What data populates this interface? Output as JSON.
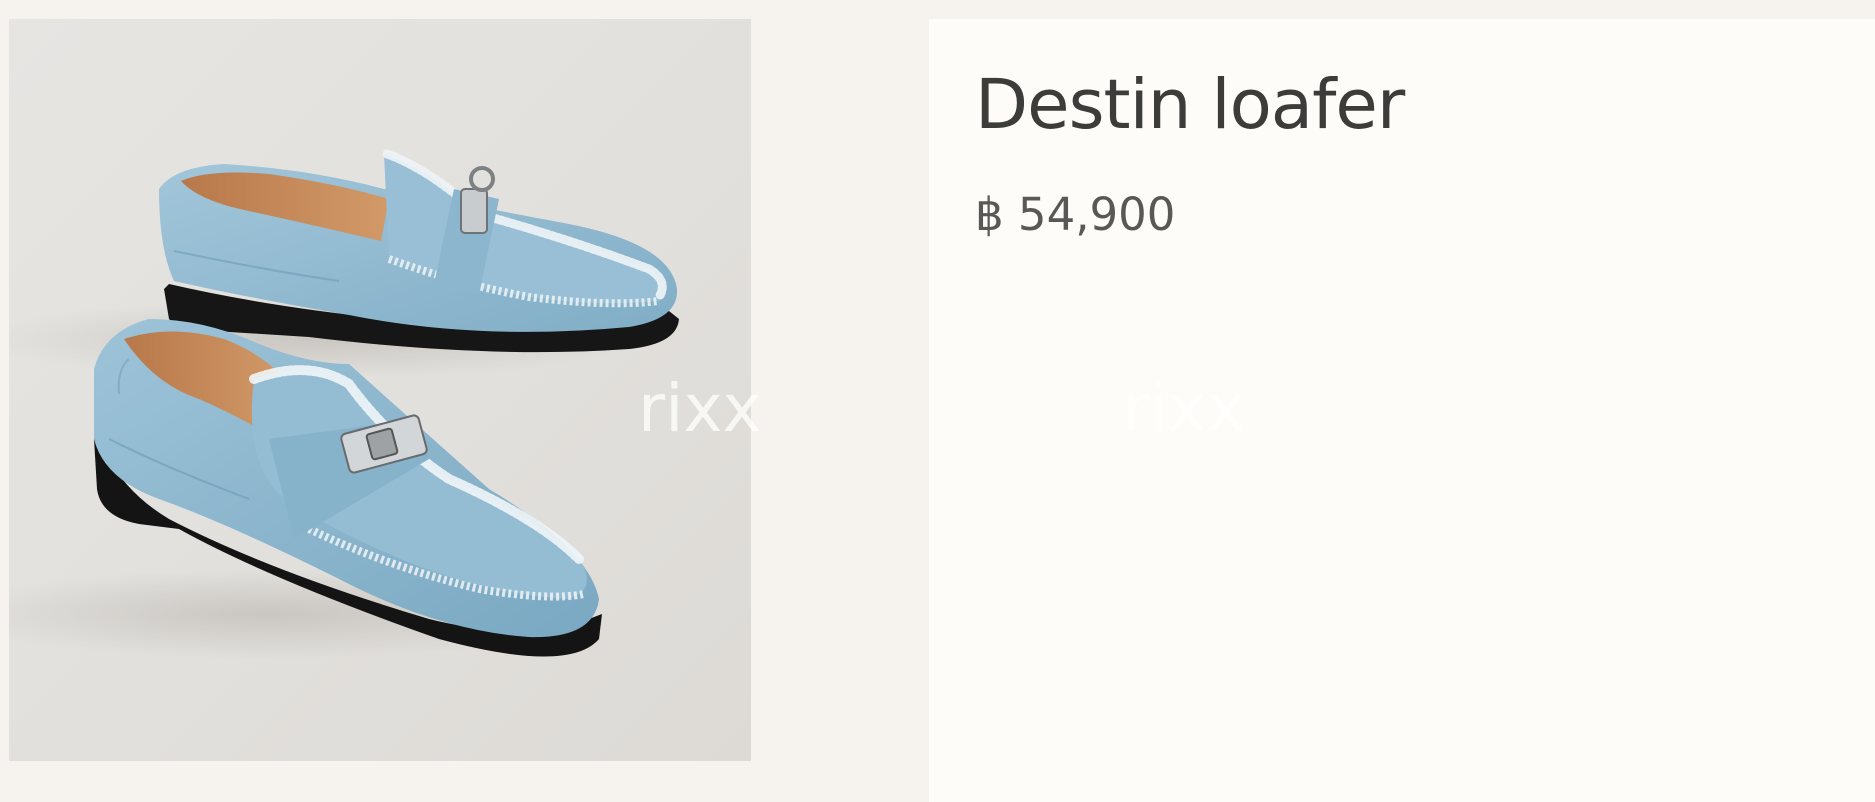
{
  "product": {
    "name": "Destin loafer",
    "price": "฿ 54,900",
    "image_alt": "Destin loafer in light blue denim with frayed edges and silver Kelly buckle"
  },
  "watermark": {
    "text_1": "rixx",
    "text_2": "rixx"
  },
  "colors": {
    "page_background": "#f6f2ee",
    "info_panel_background": "#fefcf8",
    "title_text": "#3c3c3a",
    "price_text": "#585856",
    "denim": "#8fb8cf"
  }
}
